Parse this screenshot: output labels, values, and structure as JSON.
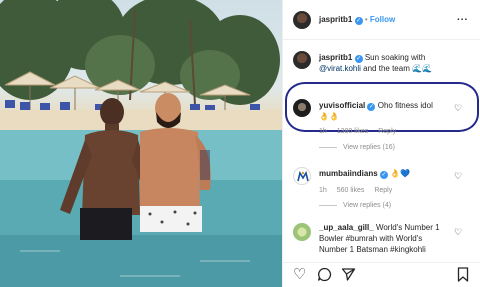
{
  "header": {
    "username": "jaspritb1",
    "verified_icon": "verified-badge-icon",
    "separator": "•",
    "follow_label": "Follow",
    "more_label": "..."
  },
  "caption": {
    "username": "jaspritb1",
    "text_1": "Sun soaking with",
    "mention": "@virat.kohli",
    "text_2": "and the team",
    "emoji": "🌊🌊"
  },
  "comments": [
    {
      "username": "yuvisofficial",
      "text": "Oho fitness idol",
      "emoji_line": "👌👌",
      "time": "1h",
      "likes": "1380 likes",
      "reply_label": "Reply",
      "view_replies": "View replies (16)"
    },
    {
      "username": "mumbaiindians",
      "emoji": "👌💙",
      "time": "1h",
      "likes": "560 likes",
      "reply_label": "Reply",
      "view_replies": "View replies (4)"
    },
    {
      "username": "_up_aala_gill_",
      "text": "World's Number 1 Bowler #bumrah with World's Number 1 Batsman #kingkohli"
    }
  ],
  "actions": {
    "like_icon": "heart-icon",
    "comment_icon": "comment-icon",
    "share_icon": "share-icon",
    "save_icon": "bookmark-icon"
  },
  "colors": {
    "accent": "#3897f0",
    "highlight_ring": "#232a8c",
    "secondary_text": "#8e8e8e"
  }
}
